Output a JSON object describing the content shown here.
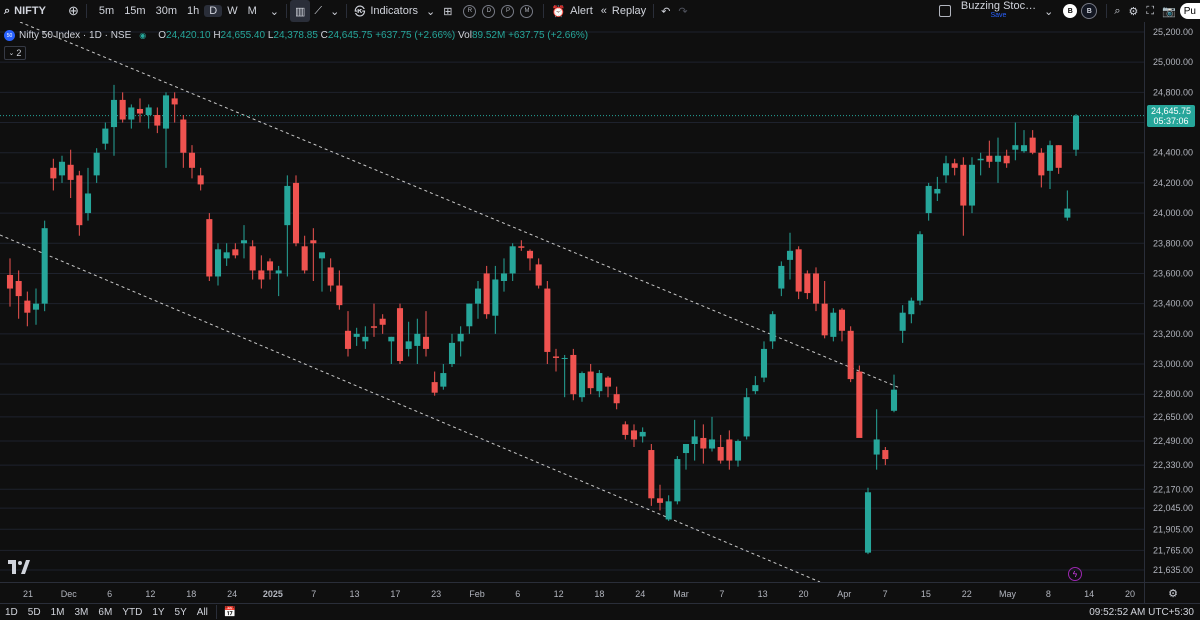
{
  "toolbar": {
    "symbol": "NIFTY",
    "intervals": [
      "5m",
      "15m",
      "30m",
      "1h",
      "D",
      "W",
      "M"
    ],
    "active_interval": "D",
    "indicators_label": "Indicators",
    "circle_buttons": [
      "R",
      "D",
      "P",
      "M"
    ],
    "alert_label": "Alert",
    "replay_label": "Replay",
    "layout_name": "Buzzing Stoc…",
    "save_label": "Save",
    "buy_label": "B",
    "sell_label": "B",
    "publish_label": "Pu"
  },
  "legend": {
    "logo": "50",
    "title": "Nifty 50 Index · 1D · NSE",
    "open_label": "O",
    "open": "24,420.10",
    "high_label": "H",
    "high": "24,655.40",
    "low_label": "L",
    "low": "24,378.85",
    "close_label": "C",
    "close": "24,645.75",
    "change": "+637.75 (+2.66%)",
    "vol_label": "Vol",
    "vol": "89.52M",
    "vol_change": "+637.75 (+2.66%)",
    "collapse_count": "2"
  },
  "price_tag": {
    "price": "24,645.75",
    "countdown": "05:37:06"
  },
  "colors": {
    "up": "#26a69a",
    "down": "#ef5350",
    "bg": "#0f0f0f",
    "grid": "#1e222d"
  },
  "time_axis": [
    {
      "label": "21"
    },
    {
      "label": "Dec"
    },
    {
      "label": "6"
    },
    {
      "label": "12"
    },
    {
      "label": "18"
    },
    {
      "label": "24"
    },
    {
      "label": "2025",
      "bold": true
    },
    {
      "label": "7"
    },
    {
      "label": "13"
    },
    {
      "label": "17"
    },
    {
      "label": "23"
    },
    {
      "label": "Feb"
    },
    {
      "label": "6"
    },
    {
      "label": "12"
    },
    {
      "label": "18"
    },
    {
      "label": "24"
    },
    {
      "label": "Mar"
    },
    {
      "label": "7"
    },
    {
      "label": "13"
    },
    {
      "label": "20"
    },
    {
      "label": "Apr"
    },
    {
      "label": "7"
    },
    {
      "label": "15"
    },
    {
      "label": "22"
    },
    {
      "label": "May"
    },
    {
      "label": "8"
    },
    {
      "label": "14"
    },
    {
      "label": "20"
    }
  ],
  "ranges": [
    "1D",
    "5D",
    "1M",
    "3M",
    "6M",
    "YTD",
    "1Y",
    "5Y",
    "All"
  ],
  "clock": "09:52:52 AM UTC+5:30",
  "chart_data": {
    "type": "candlestick",
    "y_ticks": [
      25200,
      25000,
      24800,
      24600,
      24400,
      24200,
      24000,
      23800,
      23600,
      23400,
      23200,
      23000,
      22800,
      22650,
      22490,
      22330,
      22170,
      22045,
      21905,
      21765,
      21635
    ],
    "candles": [
      {
        "o": 23590,
        "h": 23700,
        "l": 23380,
        "c": 23500
      },
      {
        "o": 23550,
        "h": 23620,
        "l": 23300,
        "c": 23450
      },
      {
        "o": 23420,
        "h": 23480,
        "l": 23250,
        "c": 23340
      },
      {
        "o": 23360,
        "h": 23500,
        "l": 23260,
        "c": 23400
      },
      {
        "o": 23400,
        "h": 23950,
        "l": 23350,
        "c": 23900
      },
      {
        "o": 24300,
        "h": 24360,
        "l": 24150,
        "c": 24230
      },
      {
        "o": 24250,
        "h": 24380,
        "l": 24200,
        "c": 24340
      },
      {
        "o": 24320,
        "h": 24420,
        "l": 24100,
        "c": 24220
      },
      {
        "o": 24250,
        "h": 24280,
        "l": 23850,
        "c": 23920
      },
      {
        "o": 24000,
        "h": 24300,
        "l": 23950,
        "c": 24130
      },
      {
        "o": 24250,
        "h": 24430,
        "l": 24200,
        "c": 24400
      },
      {
        "o": 24460,
        "h": 24600,
        "l": 24420,
        "c": 24560
      },
      {
        "o": 24570,
        "h": 24850,
        "l": 24380,
        "c": 24750
      },
      {
        "o": 24750,
        "h": 24800,
        "l": 24600,
        "c": 24620
      },
      {
        "o": 24620,
        "h": 24720,
        "l": 24560,
        "c": 24700
      },
      {
        "o": 24690,
        "h": 24760,
        "l": 24600,
        "c": 24660
      },
      {
        "o": 24650,
        "h": 24720,
        "l": 24560,
        "c": 24700
      },
      {
        "o": 24650,
        "h": 24700,
        "l": 24530,
        "c": 24580
      },
      {
        "o": 24560,
        "h": 24800,
        "l": 24300,
        "c": 24780
      },
      {
        "o": 24760,
        "h": 24800,
        "l": 24600,
        "c": 24720
      },
      {
        "o": 24620,
        "h": 24650,
        "l": 24300,
        "c": 24400
      },
      {
        "o": 24400,
        "h": 24450,
        "l": 24230,
        "c": 24300
      },
      {
        "o": 24250,
        "h": 24300,
        "l": 24150,
        "c": 24190
      },
      {
        "o": 23960,
        "h": 24000,
        "l": 23550,
        "c": 23580
      },
      {
        "o": 23580,
        "h": 23800,
        "l": 23520,
        "c": 23760
      },
      {
        "o": 23700,
        "h": 23800,
        "l": 23650,
        "c": 23740
      },
      {
        "o": 23760,
        "h": 23800,
        "l": 23700,
        "c": 23720
      },
      {
        "o": 23800,
        "h": 23920,
        "l": 23700,
        "c": 23820
      },
      {
        "o": 23780,
        "h": 23820,
        "l": 23560,
        "c": 23620
      },
      {
        "o": 23620,
        "h": 23720,
        "l": 23500,
        "c": 23560
      },
      {
        "o": 23680,
        "h": 23700,
        "l": 23560,
        "c": 23620
      },
      {
        "o": 23600,
        "h": 23650,
        "l": 23450,
        "c": 23620
      },
      {
        "o": 23920,
        "h": 24250,
        "l": 23580,
        "c": 24180
      },
      {
        "o": 24200,
        "h": 24250,
        "l": 23780,
        "c": 23800
      },
      {
        "o": 23780,
        "h": 23850,
        "l": 23600,
        "c": 23620
      },
      {
        "o": 23820,
        "h": 23900,
        "l": 23550,
        "c": 23800
      },
      {
        "o": 23700,
        "h": 23720,
        "l": 23480,
        "c": 23740
      },
      {
        "o": 23640,
        "h": 23700,
        "l": 23480,
        "c": 23520
      },
      {
        "o": 23520,
        "h": 23620,
        "l": 23360,
        "c": 23390
      },
      {
        "o": 23220,
        "h": 23350,
        "l": 23050,
        "c": 23100
      },
      {
        "o": 23180,
        "h": 23240,
        "l": 23120,
        "c": 23200
      },
      {
        "o": 23150,
        "h": 23250,
        "l": 23100,
        "c": 23180
      },
      {
        "o": 23250,
        "h": 23400,
        "l": 23180,
        "c": 23240
      },
      {
        "o": 23300,
        "h": 23330,
        "l": 23200,
        "c": 23260
      },
      {
        "o": 23150,
        "h": 23180,
        "l": 23000,
        "c": 23180
      },
      {
        "o": 23370,
        "h": 23400,
        "l": 23000,
        "c": 23020
      },
      {
        "o": 23100,
        "h": 23280,
        "l": 23050,
        "c": 23150
      },
      {
        "o": 23120,
        "h": 23300,
        "l": 23000,
        "c": 23200
      },
      {
        "o": 23180,
        "h": 23350,
        "l": 23050,
        "c": 23100
      },
      {
        "o": 22880,
        "h": 22950,
        "l": 22790,
        "c": 22810
      },
      {
        "o": 22850,
        "h": 23000,
        "l": 22830,
        "c": 22940
      },
      {
        "o": 23000,
        "h": 23200,
        "l": 22980,
        "c": 23140
      },
      {
        "o": 23150,
        "h": 23250,
        "l": 23050,
        "c": 23200
      },
      {
        "o": 23250,
        "h": 23400,
        "l": 23200,
        "c": 23400
      },
      {
        "o": 23400,
        "h": 23550,
        "l": 23300,
        "c": 23500
      },
      {
        "o": 23600,
        "h": 23650,
        "l": 23300,
        "c": 23330
      },
      {
        "o": 23320,
        "h": 23650,
        "l": 23200,
        "c": 23560
      },
      {
        "o": 23550,
        "h": 23700,
        "l": 23480,
        "c": 23600
      },
      {
        "o": 23600,
        "h": 23800,
        "l": 23550,
        "c": 23780
      },
      {
        "o": 23780,
        "h": 23820,
        "l": 23750,
        "c": 23770
      },
      {
        "o": 23750,
        "h": 23760,
        "l": 23620,
        "c": 23700
      },
      {
        "o": 23660,
        "h": 23700,
        "l": 23500,
        "c": 23520
      },
      {
        "o": 23500,
        "h": 23550,
        "l": 23000,
        "c": 23080
      },
      {
        "o": 23050,
        "h": 23100,
        "l": 22950,
        "c": 23040
      },
      {
        "o": 23040,
        "h": 23060,
        "l": 22780,
        "c": 23040
      },
      {
        "o": 23060,
        "h": 23100,
        "l": 22760,
        "c": 22800
      },
      {
        "o": 22780,
        "h": 22950,
        "l": 22750,
        "c": 22940
      },
      {
        "o": 22950,
        "h": 23000,
        "l": 22800,
        "c": 22840
      },
      {
        "o": 22820,
        "h": 22960,
        "l": 22780,
        "c": 22940
      },
      {
        "o": 22910,
        "h": 22920,
        "l": 22780,
        "c": 22850
      },
      {
        "o": 22800,
        "h": 22850,
        "l": 22700,
        "c": 22740
      },
      {
        "o": 22600,
        "h": 22620,
        "l": 22500,
        "c": 22530
      },
      {
        "o": 22560,
        "h": 22600,
        "l": 22450,
        "c": 22500
      },
      {
        "o": 22520,
        "h": 22580,
        "l": 22480,
        "c": 22550
      },
      {
        "o": 22430,
        "h": 22470,
        "l": 22060,
        "c": 22110
      },
      {
        "o": 22110,
        "h": 22200,
        "l": 22030,
        "c": 22080
      },
      {
        "o": 21970,
        "h": 22130,
        "l": 21960,
        "c": 22090
      },
      {
        "o": 22090,
        "h": 22390,
        "l": 22070,
        "c": 22370
      },
      {
        "o": 22410,
        "h": 22440,
        "l": 22300,
        "c": 22470
      },
      {
        "o": 22470,
        "h": 22630,
        "l": 22360,
        "c": 22520
      },
      {
        "o": 22510,
        "h": 22600,
        "l": 22340,
        "c": 22440
      },
      {
        "o": 22440,
        "h": 22650,
        "l": 22420,
        "c": 22500
      },
      {
        "o": 22450,
        "h": 22530,
        "l": 22340,
        "c": 22360
      },
      {
        "o": 22500,
        "h": 22560,
        "l": 22300,
        "c": 22360
      },
      {
        "o": 22360,
        "h": 22500,
        "l": 22320,
        "c": 22490
      },
      {
        "o": 22520,
        "h": 22840,
        "l": 22500,
        "c": 22780
      },
      {
        "o": 22820,
        "h": 22920,
        "l": 22800,
        "c": 22860
      },
      {
        "o": 22910,
        "h": 23150,
        "l": 22880,
        "c": 23100
      },
      {
        "o": 23150,
        "h": 23350,
        "l": 23100,
        "c": 23330
      },
      {
        "o": 23500,
        "h": 23680,
        "l": 23450,
        "c": 23650
      },
      {
        "o": 23690,
        "h": 23870,
        "l": 23560,
        "c": 23750
      },
      {
        "o": 23760,
        "h": 23780,
        "l": 23430,
        "c": 23480
      },
      {
        "o": 23600,
        "h": 23620,
        "l": 23430,
        "c": 23470
      },
      {
        "o": 23600,
        "h": 23640,
        "l": 23350,
        "c": 23400
      },
      {
        "o": 23400,
        "h": 23550,
        "l": 23170,
        "c": 23190
      },
      {
        "o": 23180,
        "h": 23370,
        "l": 23150,
        "c": 23340
      },
      {
        "o": 23360,
        "h": 23370,
        "l": 23150,
        "c": 23220
      },
      {
        "o": 23220,
        "h": 23250,
        "l": 22880,
        "c": 22900
      },
      {
        "o": 22950,
        "h": 22990,
        "l": 22530,
        "c": 22510
      },
      {
        "o": 21750,
        "h": 22180,
        "l": 21740,
        "c": 22150
      },
      {
        "o": 22400,
        "h": 22700,
        "l": 22300,
        "c": 22500
      },
      {
        "o": 22430,
        "h": 22450,
        "l": 22330,
        "c": 22370
      },
      {
        "o": 22690,
        "h": 22930,
        "l": 22680,
        "c": 22830
      },
      {
        "o": 23220,
        "h": 23390,
        "l": 23140,
        "c": 23340
      },
      {
        "o": 23330,
        "h": 23440,
        "l": 23270,
        "c": 23420
      },
      {
        "o": 23420,
        "h": 23880,
        "l": 23390,
        "c": 23860
      },
      {
        "o": 24000,
        "h": 24200,
        "l": 23950,
        "c": 24180
      },
      {
        "o": 24130,
        "h": 24240,
        "l": 24080,
        "c": 24160
      },
      {
        "o": 24250,
        "h": 24380,
        "l": 24200,
        "c": 24330
      },
      {
        "o": 24330,
        "h": 24360,
        "l": 24250,
        "c": 24300
      },
      {
        "o": 24320,
        "h": 24370,
        "l": 23850,
        "c": 24050
      },
      {
        "o": 24050,
        "h": 24370,
        "l": 24000,
        "c": 24320
      },
      {
        "o": 24350,
        "h": 24400,
        "l": 24250,
        "c": 24360
      },
      {
        "o": 24380,
        "h": 24480,
        "l": 24300,
        "c": 24340
      },
      {
        "o": 24340,
        "h": 24500,
        "l": 24200,
        "c": 24380
      },
      {
        "o": 24380,
        "h": 24420,
        "l": 24300,
        "c": 24330
      },
      {
        "o": 24420,
        "h": 24600,
        "l": 24350,
        "c": 24450
      },
      {
        "o": 24410,
        "h": 24550,
        "l": 24400,
        "c": 24450
      },
      {
        "o": 24500,
        "h": 24550,
        "l": 24390,
        "c": 24400
      },
      {
        "o": 24400,
        "h": 24430,
        "l": 24170,
        "c": 24250
      },
      {
        "o": 24280,
        "h": 24480,
        "l": 24160,
        "c": 24450
      },
      {
        "o": 24450,
        "h": 24450,
        "l": 24260,
        "c": 24300
      },
      {
        "o": 23970,
        "h": 24150,
        "l": 23950,
        "c": 24030
      },
      {
        "o": 24420.1,
        "h": 24655.4,
        "l": 24378.85,
        "c": 24645.75
      }
    ],
    "current_price": 24645.75
  }
}
